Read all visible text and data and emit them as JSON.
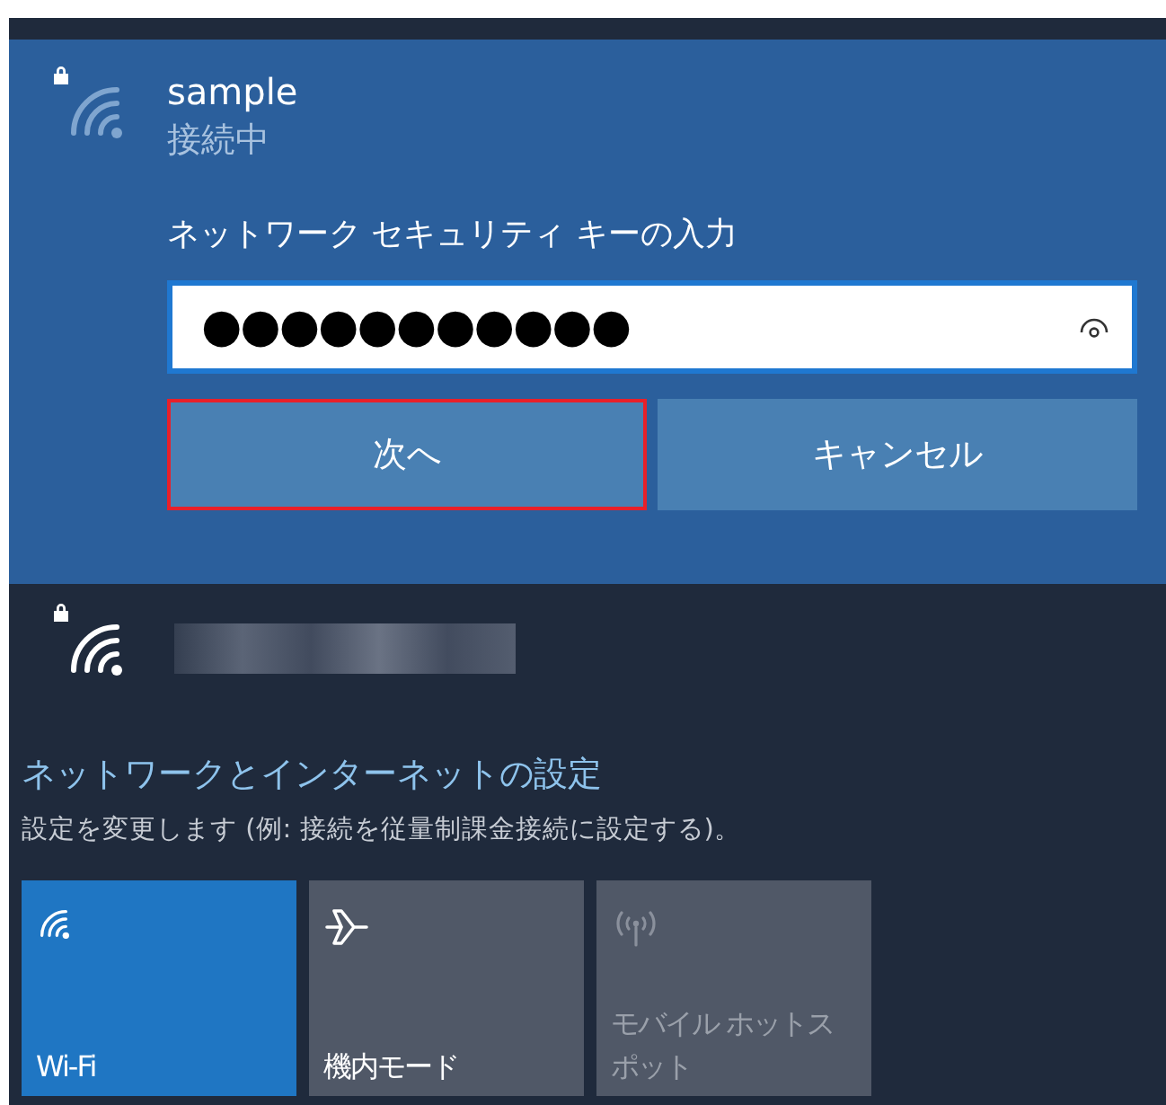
{
  "active_network": {
    "name": "sample",
    "status": "接続中",
    "key_label": "ネットワーク セキュリティ キーの入力",
    "key_value": "●●●●●●●●●●●",
    "buttons": [
      {
        "label": "次へ",
        "highlighted": true
      },
      {
        "label": "キャンセル",
        "highlighted": false
      }
    ]
  },
  "other_network": {
    "name_redacted": true
  },
  "settings_link": {
    "title": "ネットワークとインターネットの設定",
    "description": "設定を変更します (例: 接続を従量制課金接続に設定する)。"
  },
  "quick_actions": [
    {
      "kind": "wifi",
      "label": "Wi-Fi",
      "on": true,
      "disabled": false
    },
    {
      "kind": "airplane",
      "label": "機内モード",
      "on": false,
      "disabled": false
    },
    {
      "kind": "hotspot",
      "label": "モバイル ホットスポット",
      "on": false,
      "disabled": true
    }
  ]
}
